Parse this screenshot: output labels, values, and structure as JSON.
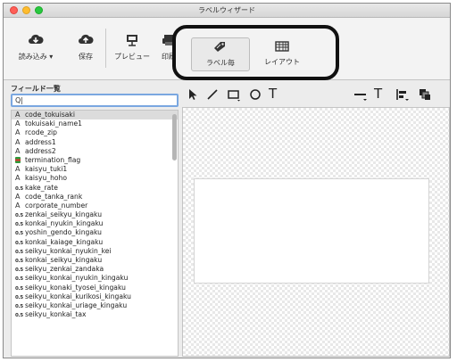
{
  "window": {
    "title": "ラベルウィザード"
  },
  "toolbar": {
    "buttons": [
      {
        "label": "読み込み ▾",
        "icon": "cloud-download-icon"
      },
      {
        "label": "保存",
        "icon": "cloud-upload-icon"
      },
      {
        "label": "プレビュー",
        "icon": "preview-icon"
      },
      {
        "label": "印刷",
        "icon": "printer-icon"
      }
    ],
    "tabs": [
      {
        "label": "ラベル毎",
        "icon": "tag-icon",
        "selected": true
      },
      {
        "label": "レイアウト",
        "icon": "layout-icon",
        "selected": false
      }
    ]
  },
  "field_panel": {
    "title": "フィールド一覧",
    "search_value": "Q|",
    "fields": [
      {
        "type": "text",
        "name": "code_tokuisaki"
      },
      {
        "type": "text",
        "name": "tokuisaki_name1"
      },
      {
        "type": "text",
        "name": "rcode_zip"
      },
      {
        "type": "text",
        "name": "address1"
      },
      {
        "type": "text",
        "name": "address2"
      },
      {
        "type": "flag",
        "name": "termination_flag"
      },
      {
        "type": "text",
        "name": "kaisyu_tuki1"
      },
      {
        "type": "text",
        "name": "kaisyu_hoho"
      },
      {
        "type": "number",
        "name": "kake_rate"
      },
      {
        "type": "text",
        "name": "code_tanka_rank"
      },
      {
        "type": "text",
        "name": "corporate_number"
      },
      {
        "type": "number",
        "name": "zenkai_seikyu_kingaku"
      },
      {
        "type": "number",
        "name": "konkai_nyukin_kingaku"
      },
      {
        "type": "number",
        "name": "yoshin_gendo_kingaku"
      },
      {
        "type": "number",
        "name": "konkai_kaiage_kingaku"
      },
      {
        "type": "number",
        "name": "seikyu_konkai_nyukin_kei"
      },
      {
        "type": "number",
        "name": "konkai_seikyu_kingaku"
      },
      {
        "type": "number",
        "name": "seikyu_zenkai_zandaka"
      },
      {
        "type": "number",
        "name": "seikyu_konkai_nyukin_kingaku"
      },
      {
        "type": "number",
        "name": "seikyu_konaki_tyosei_kingaku"
      },
      {
        "type": "number",
        "name": "seikyu_konkai_kurikosi_kingaku"
      },
      {
        "type": "number",
        "name": "seikyu_konkai_uriage_kingaku"
      },
      {
        "type": "number",
        "name": "seikyu_konkai_tax"
      }
    ],
    "type_glyphs": {
      "text": "A",
      "number": "0.5",
      "flag": ""
    }
  },
  "canvas_tools": [
    "pointer-arrow-icon",
    "line-tool-icon",
    "rectangle-tool-icon",
    "ellipse-tool-icon",
    "text-tool-icon",
    "line-weight-icon",
    "font-style-icon",
    "align-icon",
    "arrange-icon"
  ],
  "canvas_tool_text": {
    "text_tool": "T",
    "font_style": "T"
  }
}
